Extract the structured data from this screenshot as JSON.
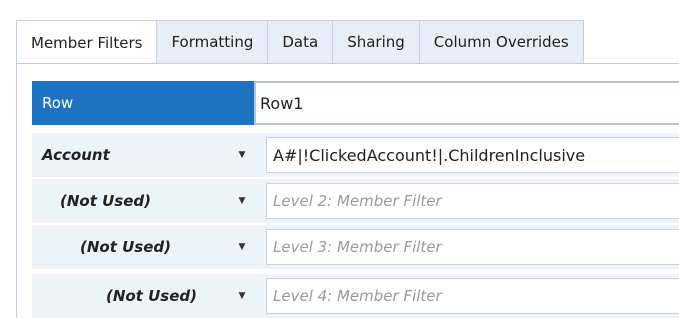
{
  "tabs": [
    {
      "label": "Member Filters",
      "active": true
    },
    {
      "label": "Formatting",
      "active": false
    },
    {
      "label": "Data",
      "active": false
    },
    {
      "label": "Sharing",
      "active": false
    },
    {
      "label": "Column Overrides",
      "active": false
    }
  ],
  "header": {
    "label": "Row",
    "value": "Row1"
  },
  "filters": [
    {
      "dimension": "Account",
      "value": "A#|!ClickedAccount!|.ChildrenInclusive",
      "placeholder": ""
    },
    {
      "dimension": "(Not Used)",
      "value": "",
      "placeholder": "Level 2: Member Filter"
    },
    {
      "dimension": "(Not Used)",
      "value": "",
      "placeholder": "Level 3: Member Filter"
    },
    {
      "dimension": "(Not Used)",
      "value": "",
      "placeholder": "Level 4: Member Filter"
    }
  ],
  "colors": {
    "header_bg": "#1e72c0",
    "tab_bg": "#e9eef6",
    "row_bg": "#eef3f9"
  }
}
